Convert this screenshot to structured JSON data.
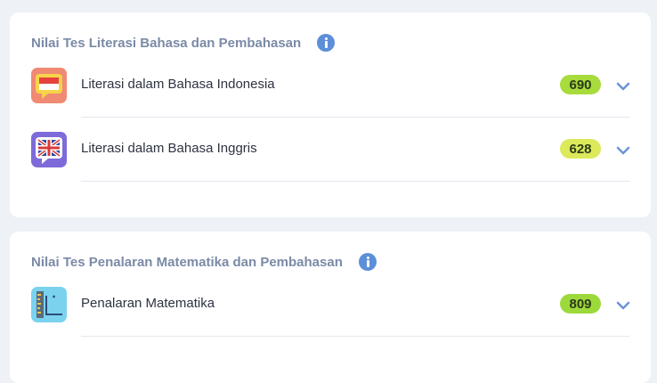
{
  "sections": [
    {
      "title": "Nilai Tes Literasi Bahasa dan Pembahasan",
      "items": [
        {
          "label": "Literasi dalam Bahasa Indonesia",
          "score": "690",
          "score_color": "#a8db3c",
          "icon": "indonesia-flag-chat-icon"
        },
        {
          "label": "Literasi dalam Bahasa Inggris",
          "score": "628",
          "score_color": "#dbe95a",
          "icon": "uk-flag-chat-icon"
        }
      ]
    },
    {
      "title": "Nilai Tes Penalaran Matematika dan Pembahasan",
      "items": [
        {
          "label": "Penalaran Matematika",
          "score": "809",
          "score_color": "#9ed93c",
          "icon": "math-ruler-icon"
        }
      ]
    }
  ],
  "colors": {
    "info": "#5d8fd8",
    "chevron": "#6a95d6",
    "title": "#7b8aa6"
  }
}
